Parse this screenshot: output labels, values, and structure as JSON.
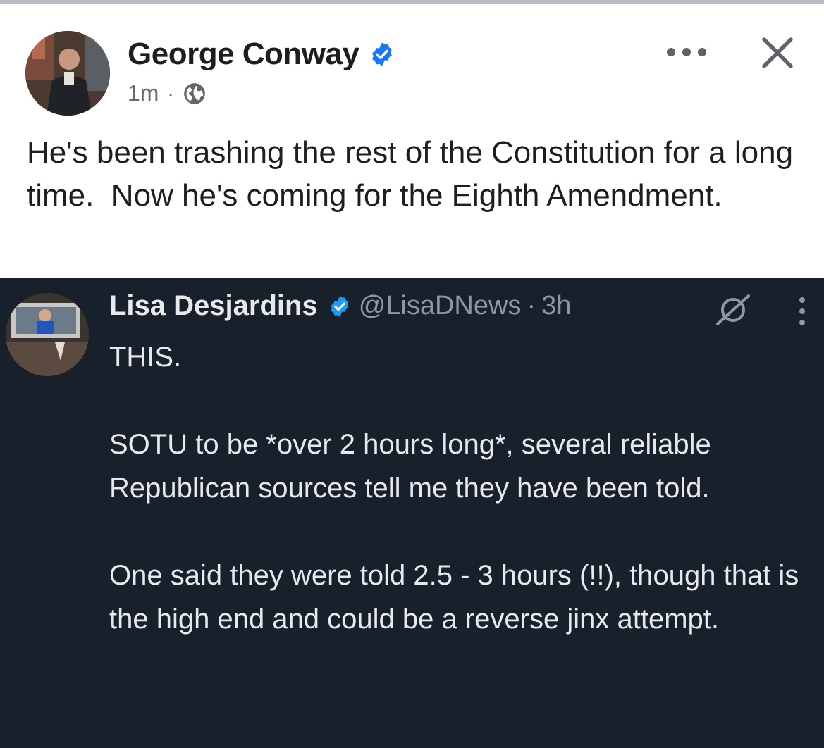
{
  "post": {
    "author": "George Conway",
    "time": "1m",
    "separator": "·",
    "text": "He's been trashing the rest of the Constitution for a long time.  Now he's coming for the Eighth Amendment."
  },
  "embedded_tweet": {
    "name": "Lisa Desjardins",
    "handle": "@LisaDNews",
    "time_sep": "·",
    "time": "3h",
    "text": "THIS.\n\nSOTU to be *over 2 hours long*, several reliable Republican sources tell me they have been told.\n\nOne said they were told 2.5 - 3 hours (!!), though that is the high end and could be a reverse jinx attempt."
  },
  "icons": {
    "verified": "verified-badge-icon",
    "globe": "globe-icon",
    "more": "more-horizontal-icon",
    "close": "close-icon",
    "grok": "grok-icon",
    "more_vertical": "more-vertical-icon"
  },
  "colors": {
    "fb_text": "#1c1e21",
    "fb_meta": "#65676b",
    "fb_verified": "#1877f2",
    "tweet_bg": "#17202b",
    "tweet_text": "#e7e9ea",
    "tweet_secondary": "#8b98a5",
    "x_verified": "#1d9bf0"
  }
}
